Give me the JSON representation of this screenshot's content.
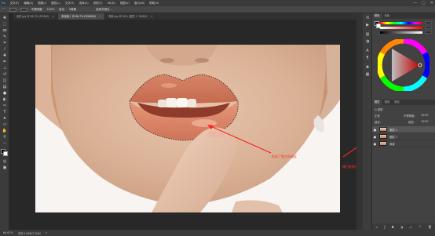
{
  "menu": [
    "文件(F)",
    "编辑(E)",
    "图像(I)",
    "图层(L)",
    "文字(Y)",
    "选择(S)",
    "滤镜(T)",
    "3D(D)",
    "视图(V)",
    "窗口(W)",
    "帮助(H)"
  ],
  "window_controls": [
    "—",
    "▢",
    "✕"
  ],
  "options": {
    "label1": "不透明度:",
    "label2": "100%",
    "label3": "羽化:",
    "label4": "0像素",
    "label5": "选择并遮住..."
  },
  "tabs": [
    {
      "label": "素材.jpg @ 66.7% (RGB/8)",
      "active": false
    },
    {
      "label": "未标题-1 @ 66.7% (RGB/8#)",
      "active": true
    },
    {
      "label": "嘴唇.jpg @ 80% (图层 1, RGB/8)",
      "active": false
    }
  ],
  "status": {
    "zoom": "66.67%",
    "doc": "文档:3.88M/7.82M",
    "arrow": ">"
  },
  "panels": {
    "color_tabs": [
      "颜色",
      "色板"
    ],
    "layer_tabs": [
      "图层",
      "通道",
      "路径"
    ],
    "kind_label": "Q 类型",
    "blend_mode": "正常",
    "opacity_label": "不透明度:",
    "opacity_value": "100%",
    "lock_label": "锁定:",
    "fill_label": "填充:",
    "fill_value": "100%",
    "layers": [
      {
        "name": "图层 2",
        "selected": true
      },
      {
        "name": "图层 1",
        "selected": false
      },
      {
        "name": "背景",
        "selected": false
      }
    ]
  },
  "annotations": {
    "lips": "形成了独立的选区",
    "layer": "嘴巴复制出来的图层"
  },
  "colors": {
    "accent": "#ff2020",
    "bg": "#282828"
  }
}
